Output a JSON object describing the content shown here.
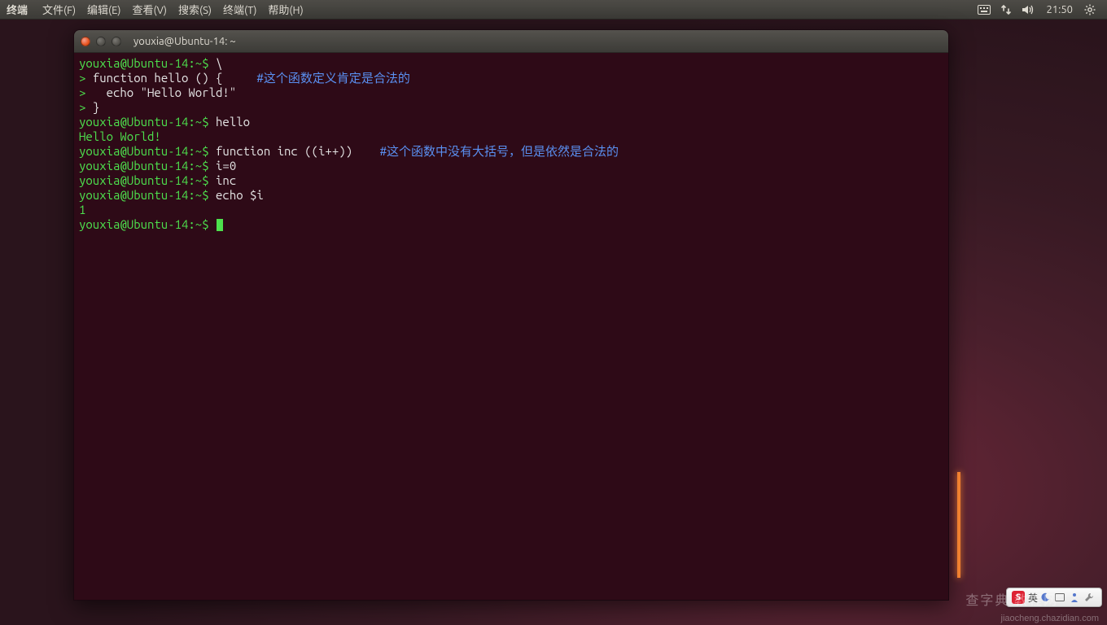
{
  "menubar": {
    "app": "终端",
    "items": [
      "文件(F)",
      "编辑(E)",
      "查看(V)",
      "搜索(S)",
      "终端(T)",
      "帮助(H)"
    ],
    "clock": "21:50"
  },
  "window": {
    "title": "youxia@Ubuntu-14: ~"
  },
  "term": {
    "l1_prompt": "youxia@Ubuntu-14:~$ ",
    "l1_cmd": "\\",
    "l2_cont": "> ",
    "l2_cmd": "function hello () {     ",
    "l2_comment": "#这个函数定义肯定是合法的",
    "l3_cont": ">   ",
    "l3_cmd": "echo \"Hello World!\"",
    "l4_cont": "> ",
    "l4_cmd": "}",
    "l5_prompt": "youxia@Ubuntu-14:~$ ",
    "l5_cmd": "hello",
    "l6_out": "Hello World!",
    "l7_prompt": "youxia@Ubuntu-14:~$ ",
    "l7_cmd": "function inc ((i++))    ",
    "l7_comment": "#这个函数中没有大括号，但是依然是合法的",
    "l8_prompt": "youxia@Ubuntu-14:~$ ",
    "l8_cmd": "i=0",
    "l9_prompt": "youxia@Ubuntu-14:~$ ",
    "l9_cmd": "inc",
    "l10_prompt": "youxia@Ubuntu-14:~$ ",
    "l10_cmd": "echo $i",
    "l11_out": "1",
    "l12_prompt": "youxia@Ubuntu-14:~$ "
  },
  "ime": {
    "s": "S",
    "lang": "英"
  },
  "watermark": {
    "big": "查字典 教程网",
    "url": "jiaocheng.chazidian.com"
  }
}
